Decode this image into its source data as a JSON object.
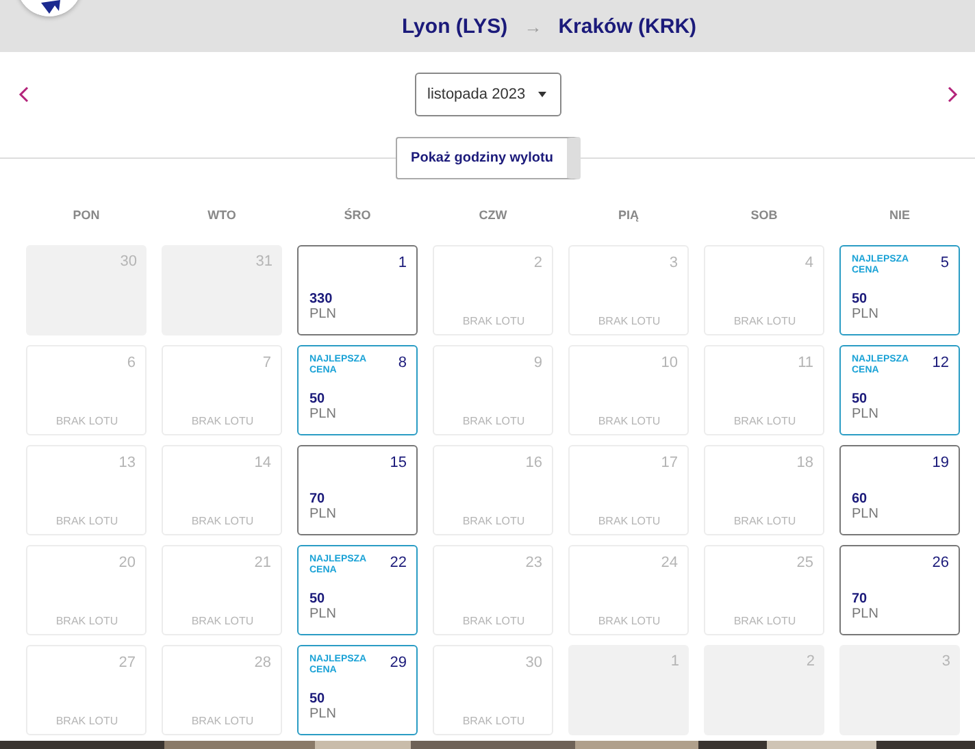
{
  "header": {
    "origin": "Lyon (LYS)",
    "arrow": "→",
    "destination": "Kraków (KRK)"
  },
  "nav": {
    "month": "listopada 2023",
    "toggle": "Pokaż godziny wylotu"
  },
  "weekdays": [
    "PON",
    "WTO",
    "ŚRO",
    "CZW",
    "PIĄ",
    "SOB",
    "NIE"
  ],
  "days": [
    {
      "day": "30",
      "kind": "outside"
    },
    {
      "day": "31",
      "kind": "outside"
    },
    {
      "day": "1",
      "kind": "price",
      "price": "330",
      "currency": "PLN"
    },
    {
      "day": "2",
      "kind": "none",
      "note": "BRAK LOTU"
    },
    {
      "day": "3",
      "kind": "none",
      "note": "BRAK LOTU"
    },
    {
      "day": "4",
      "kind": "none",
      "note": "BRAK LOTU"
    },
    {
      "day": "5",
      "kind": "best",
      "badge": "NAJLEPSZA CENA",
      "price": "50",
      "currency": "PLN"
    },
    {
      "day": "6",
      "kind": "none",
      "note": "BRAK LOTU"
    },
    {
      "day": "7",
      "kind": "none",
      "note": "BRAK LOTU"
    },
    {
      "day": "8",
      "kind": "best",
      "badge": "NAJLEPSZA CENA",
      "price": "50",
      "currency": "PLN"
    },
    {
      "day": "9",
      "kind": "none",
      "note": "BRAK LOTU"
    },
    {
      "day": "10",
      "kind": "none",
      "note": "BRAK LOTU"
    },
    {
      "day": "11",
      "kind": "none",
      "note": "BRAK LOTU"
    },
    {
      "day": "12",
      "kind": "best",
      "badge": "NAJLEPSZA CENA",
      "price": "50",
      "currency": "PLN"
    },
    {
      "day": "13",
      "kind": "none",
      "note": "BRAK LOTU"
    },
    {
      "day": "14",
      "kind": "none",
      "note": "BRAK LOTU"
    },
    {
      "day": "15",
      "kind": "price",
      "price": "70",
      "currency": "PLN"
    },
    {
      "day": "16",
      "kind": "none",
      "note": "BRAK LOTU"
    },
    {
      "day": "17",
      "kind": "none",
      "note": "BRAK LOTU"
    },
    {
      "day": "18",
      "kind": "none",
      "note": "BRAK LOTU"
    },
    {
      "day": "19",
      "kind": "price",
      "price": "60",
      "currency": "PLN"
    },
    {
      "day": "20",
      "kind": "none",
      "note": "BRAK LOTU"
    },
    {
      "day": "21",
      "kind": "none",
      "note": "BRAK LOTU"
    },
    {
      "day": "22",
      "kind": "best",
      "badge": "NAJLEPSZA CENA",
      "price": "50",
      "currency": "PLN"
    },
    {
      "day": "23",
      "kind": "none",
      "note": "BRAK LOTU"
    },
    {
      "day": "24",
      "kind": "none",
      "note": "BRAK LOTU"
    },
    {
      "day": "25",
      "kind": "none",
      "note": "BRAK LOTU"
    },
    {
      "day": "26",
      "kind": "price",
      "price": "70",
      "currency": "PLN"
    },
    {
      "day": "27",
      "kind": "none",
      "note": "BRAK LOTU"
    },
    {
      "day": "28",
      "kind": "none",
      "note": "BRAK LOTU"
    },
    {
      "day": "29",
      "kind": "best",
      "badge": "NAJLEPSZA CENA",
      "price": "50",
      "currency": "PLN"
    },
    {
      "day": "30",
      "kind": "none",
      "note": "BRAK LOTU"
    },
    {
      "day": "1",
      "kind": "outside"
    },
    {
      "day": "2",
      "kind": "outside"
    },
    {
      "day": "3",
      "kind": "outside"
    }
  ]
}
